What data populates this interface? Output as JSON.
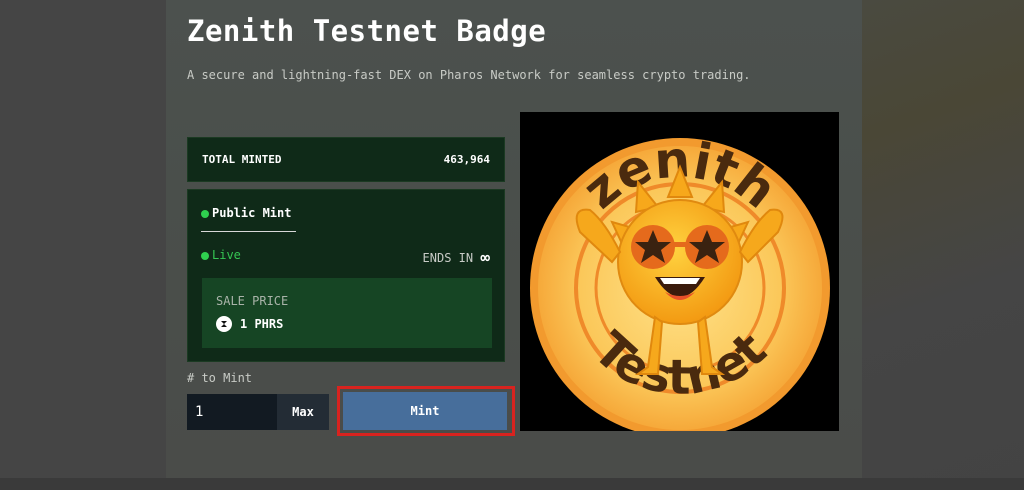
{
  "header": {
    "title": "Zenith Testnet Badge",
    "subtitle": "A secure and lightning-fast DEX on Pharos Network for seamless crypto trading."
  },
  "stats": {
    "total_minted_label": "TOTAL MINTED",
    "total_minted_value": "463,964"
  },
  "mint_phase": {
    "phase_label": "Public Mint",
    "status_label": "Live",
    "ends_label": "ENDS IN",
    "ends_value": "∞",
    "sale_price_label": "SALE PRICE",
    "sale_price_value": "1 PHRS",
    "token_icon": "pharos-token-icon"
  },
  "mint_form": {
    "quantity_label": "# to Mint",
    "quantity_value": "1",
    "max_label": "Max",
    "mint_label": "Mint"
  },
  "badge_image": {
    "top_text": "zenith",
    "bottom_text": "Testnet"
  },
  "colors": {
    "accent_live": "#35c753",
    "mint_button": "#476e9b",
    "highlight": "#d8231f",
    "card_bg": "#0f2a18"
  }
}
